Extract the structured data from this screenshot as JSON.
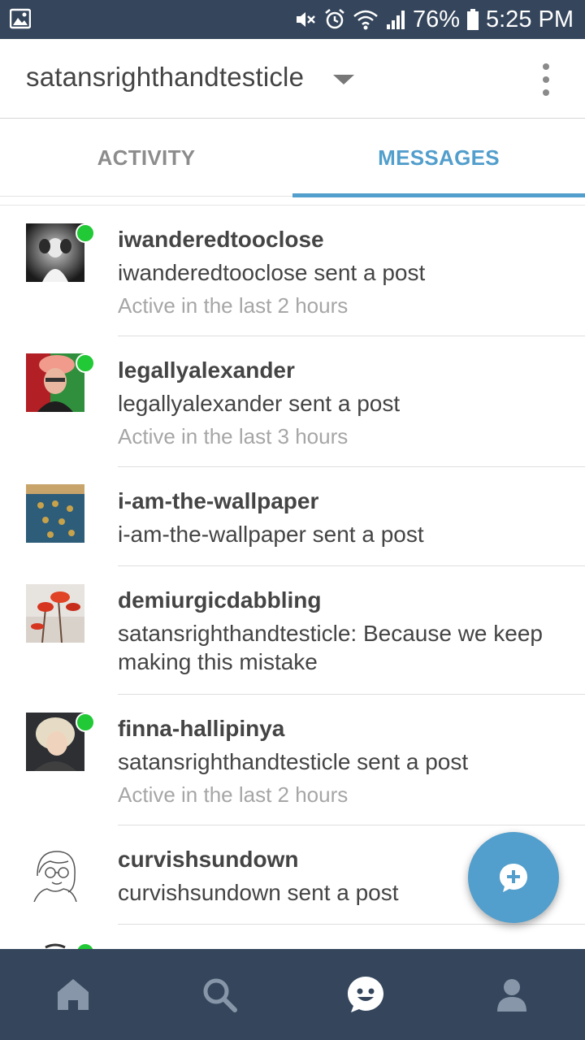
{
  "status_bar": {
    "battery": "76%",
    "time": "5:25 PM"
  },
  "header": {
    "blog_name": "satansrighthandtesticle"
  },
  "tabs": [
    {
      "label": "ACTIVITY",
      "active": false
    },
    {
      "label": "MESSAGES",
      "active": true
    }
  ],
  "conversations": [
    {
      "name": "iwanderedtooclose",
      "message": "iwanderedtooclose sent a post",
      "active": "Active in the last 2 hours",
      "online": true
    },
    {
      "name": "legallyalexander",
      "message": "legallyalexander sent a post",
      "active": "Active in the last 3 hours",
      "online": true
    },
    {
      "name": "i-am-the-wallpaper",
      "message": "i-am-the-wallpaper sent a post",
      "online": false
    },
    {
      "name": "demiurgicdabbling",
      "message": "satansrighthandtesticle: Because we keep making this mistake",
      "online": false
    },
    {
      "name": "finna-hallipinya",
      "message": "satansrighthandtesticle sent a post",
      "active": "Active in the last 2 hours",
      "online": true
    },
    {
      "name": "curvishsundown",
      "message": "curvishsundown sent a post",
      "online": false
    }
  ],
  "bottom_nav": [
    {
      "icon": "home-icon"
    },
    {
      "icon": "search-icon"
    },
    {
      "icon": "messaging-icon",
      "active": true
    },
    {
      "icon": "account-icon"
    }
  ],
  "colors": {
    "accent": "#529ecc",
    "navbar": "#35465c",
    "online": "#20c935"
  }
}
